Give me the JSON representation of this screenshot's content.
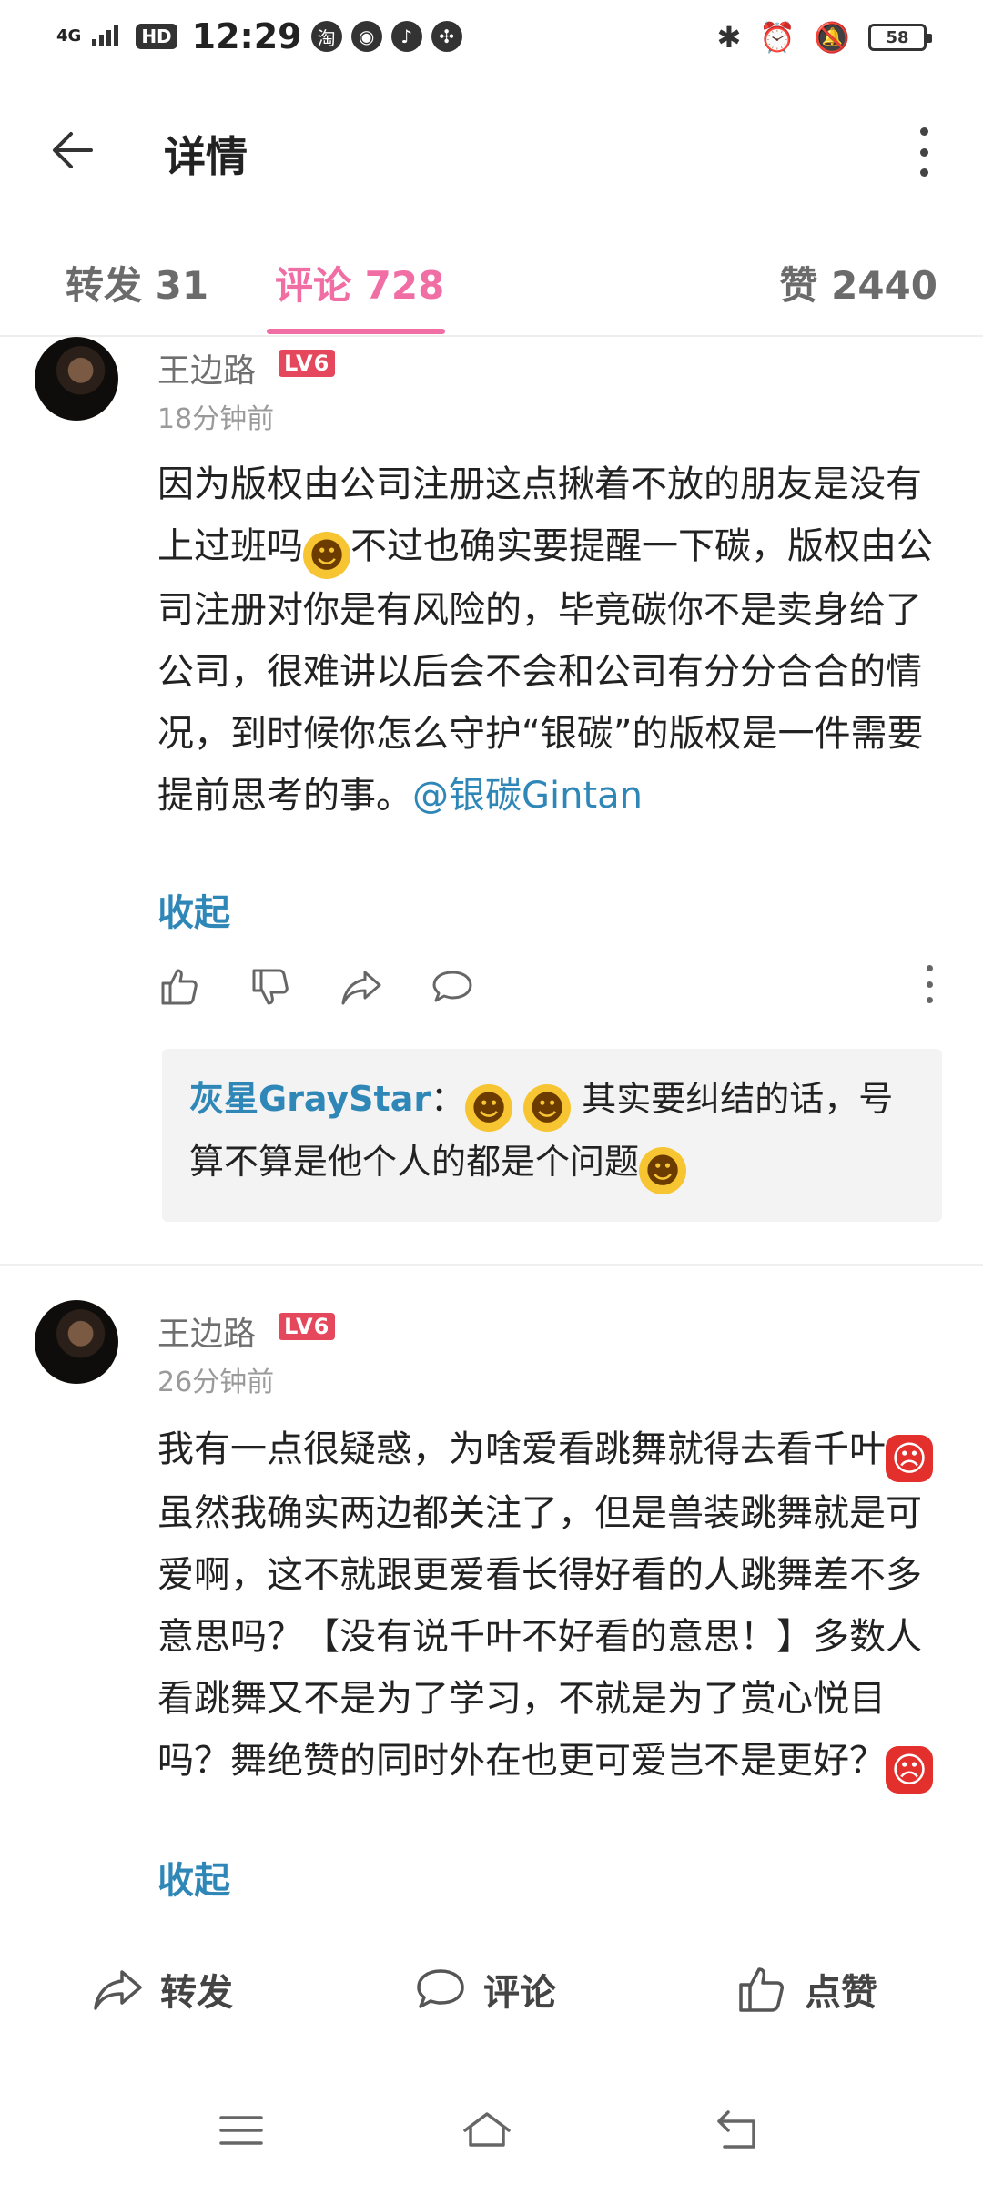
{
  "status_bar": {
    "network": "4G",
    "hd": "HD",
    "time": "12:29",
    "app_icons": [
      "taobao-icon",
      "compass-icon",
      "music-icon",
      "fan-icon"
    ],
    "battery": "58"
  },
  "app_bar": {
    "title": "详情"
  },
  "tabs": [
    {
      "label": "转发 31"
    },
    {
      "label": "评论 728"
    },
    {
      "label": "赞 2440"
    }
  ],
  "comments": [
    {
      "user": "王边路",
      "level": "LV6",
      "time": "18分钟前",
      "text_1": "因为版权由公司注册这点揪着不放的朋友是没有上过班吗",
      "text_2": "不过也确实要提醒一下碳，版权由公司注册对你是有风险的，毕竟碳你不是卖身给了公司，很难讲以后会不会和公司有分分合合的情况，到时候你怎么守护“银碳”的版权是一件需要提前思考的事。",
      "mention": "@银碳Gintan",
      "collapse": "收起",
      "reply": {
        "user": "灰星GrayStar",
        "text_1": "其实要纠结的话，号算不算是他个人的都是个问题"
      }
    },
    {
      "user": "王边路",
      "level": "LV6",
      "time": "26分钟前",
      "text_1": "我有一点很疑惑，为啥爱看跳舞就得去看千叶",
      "text_2": "虽然我确实两边都关注了，但是兽装跳舞就是可爱啊，这不就跟更爱看长得好看的人跳舞差不多意思吗？【没有说千叶不好看的意思！】多数人看跳舞又不是为了学习，不就是为了赏心悦目吗？舞绝赞的同时外在也更可爱岂不是更好？",
      "collapse": "收起"
    }
  ],
  "bottom_bar": {
    "repost": "转发",
    "comment": "评论",
    "like": "点赞"
  },
  "colors": {
    "accent_pink": "#f06ea4",
    "link_blue": "#2f87b8",
    "level_red": "#e5485c"
  }
}
